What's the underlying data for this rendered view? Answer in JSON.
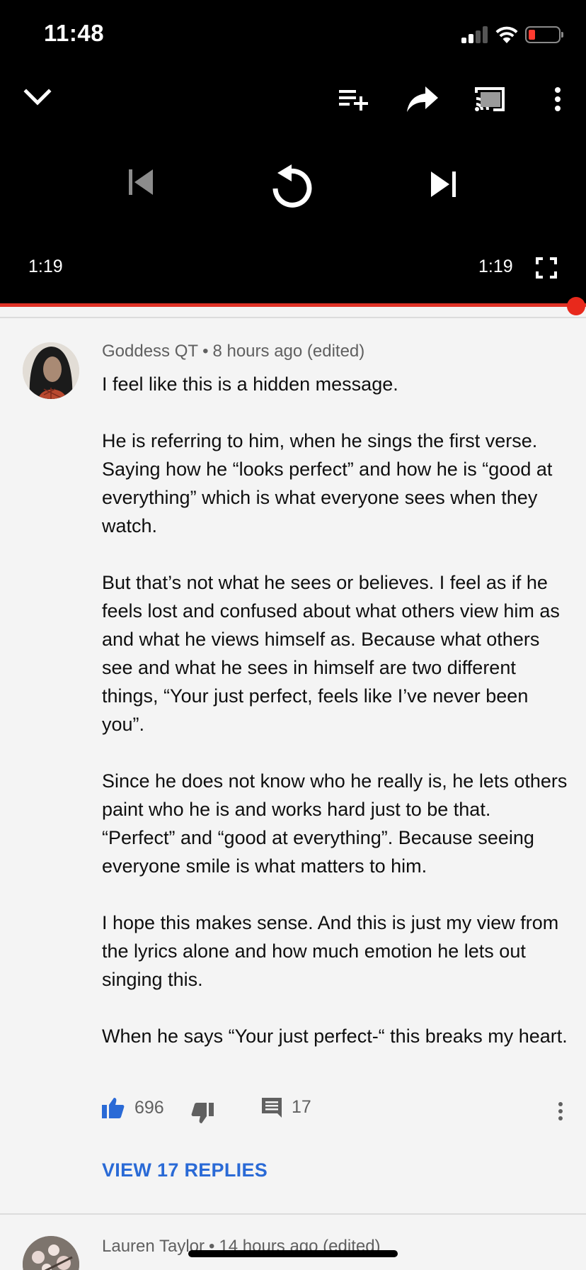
{
  "status_bar": {
    "time": "11:48",
    "battery_color": "#ff3b30"
  },
  "player": {
    "time_elapsed": "1:19",
    "time_total": "1:19",
    "progress_fraction": 1.0,
    "progress_color": "#e03226",
    "icons": [
      "chevron-down-icon",
      "add-to-queue-icon",
      "share-icon",
      "cast-icon",
      "more-vert-icon",
      "previous-icon",
      "replay-icon",
      "next-icon",
      "fullscreen-icon"
    ]
  },
  "comment": {
    "author": "Goddess QT",
    "separator": "•",
    "time": "8 hours ago (edited)",
    "paragraphs": [
      "I feel like this is a hidden message.",
      "He is referring to him, when he sings the first verse. Saying how he “looks perfect” and how he is “good at everything” which is what everyone sees when they watch.",
      "But that’s not what he sees or believes. I feel as if he feels lost and confused about what others view him as and what he views himself as. Because what others see and what he sees in himself are two different things, “Your just perfect, feels like I’ve never been you”.",
      "Since he does not know who he really is, he lets others paint who he is and works hard just to be that. “Perfect” and “good at everything”. Because seeing everyone smile is what matters to him.",
      "I hope this makes sense. And this is just my view from the lyrics alone and how much emotion he lets out singing this.",
      "When he says “Your just perfect-“ this breaks my heart."
    ],
    "likes": "696",
    "replies_count": "17",
    "view_replies_label": "VIEW 17 REPLIES",
    "like_color": "#2a6ad6"
  },
  "next_comment": {
    "author": "Lauren Taylor",
    "separator": "•",
    "time": "14 hours ago (edited)"
  }
}
